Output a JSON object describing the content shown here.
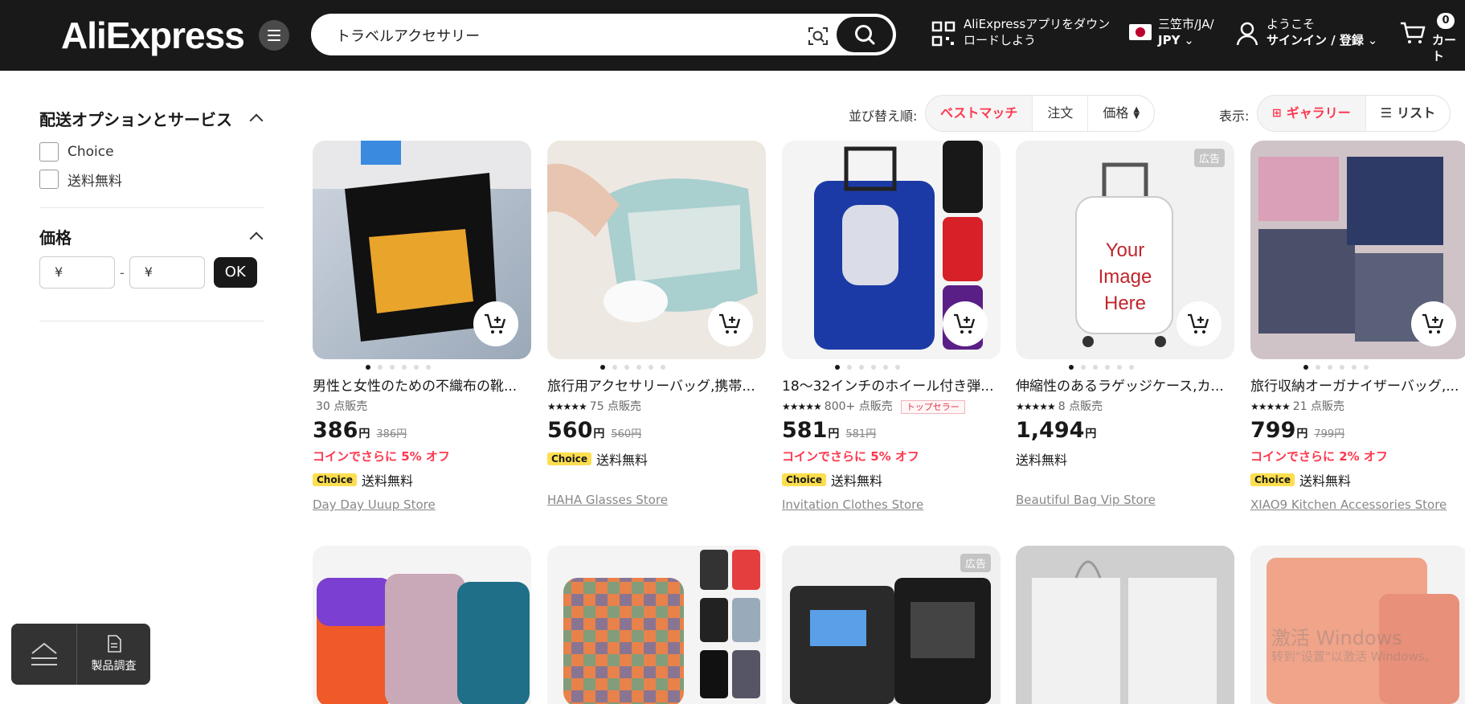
{
  "header": {
    "logo_text": "AliExpress",
    "search_value": "トラベルアクセサリー",
    "app_promo_line1": "AliExpressアプリをダウン",
    "app_promo_line2": "ロードしよう",
    "region_line1": "三笠市/JA/",
    "region_line2": "JPY",
    "welcome": "ようこそ",
    "signin": "サインイン / 登録",
    "cart_count": "0",
    "cart_label": "カート"
  },
  "sidebar": {
    "shipping_title": "配送オプションとサービス",
    "options": [
      {
        "label": "Choice"
      },
      {
        "label": "送料無料"
      }
    ],
    "price_title": "価格",
    "min_placeholder": "¥",
    "max_placeholder": "¥",
    "ok_label": "OK"
  },
  "sort": {
    "label": "並び替え順:",
    "options": [
      "ベストマッチ",
      "注文",
      "価格"
    ],
    "active": "ベストマッチ",
    "view_label": "表示:",
    "views": [
      "ギャラリー",
      "リスト"
    ],
    "active_view": "ギャラリー"
  },
  "products": [
    {
      "title": "男性と女性のための不織布の靴...",
      "rating": "",
      "sold": "30 点販売",
      "top_seller": "",
      "price": "386",
      "yen": "円",
      "old_price": "386円",
      "coin": "コインでさらに 5% オフ",
      "choice": "Choice",
      "shipping": "送料無料",
      "store": "Day Day Uuup Store",
      "ad": ""
    },
    {
      "title": "旅行用アクセサリーバッグ,携帯...",
      "rating": "★★★★★",
      "sold": "75 点販売",
      "top_seller": "",
      "price": "560",
      "yen": "円",
      "old_price": "560円",
      "coin": "",
      "choice": "Choice",
      "shipping": "送料無料",
      "store": "HAHA Glasses Store",
      "ad": ""
    },
    {
      "title": "18〜32インチのホイール付き弾...",
      "rating": "★★★★★",
      "sold": "800+ 点販売",
      "top_seller": "トップセラー",
      "price": "581",
      "yen": "円",
      "old_price": "581円",
      "coin": "コインでさらに 5% オフ",
      "choice": "Choice",
      "shipping": "送料無料",
      "store": "Invitation Clothes Store",
      "ad": ""
    },
    {
      "title": "伸縮性のあるラゲッジケース,カ...",
      "rating": "★★★★★",
      "sold": "8 点販売",
      "top_seller": "",
      "price": "1,494",
      "yen": "円",
      "old_price": "",
      "coin": "",
      "choice": "",
      "shipping": "送料無料",
      "store": "Beautiful Bag Vip Store",
      "ad": "広告",
      "image_text": "Your Image Here"
    },
    {
      "title": "旅行収納オーガナイザーバッグ,...",
      "rating": "★★★★★",
      "sold": "21 点販売",
      "top_seller": "",
      "price": "799",
      "yen": "円",
      "old_price": "799円",
      "coin": "コインでさらに 2% オフ",
      "choice": "Choice",
      "shipping": "送料無料",
      "store": "XIAO9 Kitchen Accessories Store",
      "ad": ""
    }
  ],
  "row2_ads": [
    "広告"
  ],
  "floating": {
    "survey": "製品調査"
  },
  "watermark": {
    "line1": "激活 Windows",
    "line2": "转到\"设置\"以激活 Windows。"
  },
  "colors": {
    "accent": "#fd384f",
    "header_bg": "#191919",
    "choice_bg": "#fdde4f"
  }
}
